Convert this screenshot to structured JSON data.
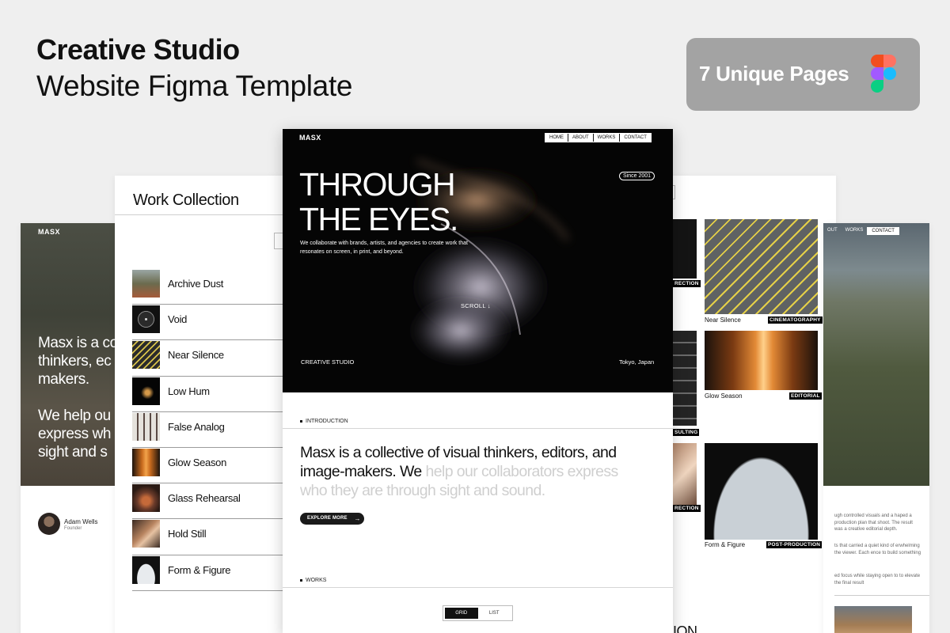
{
  "header": {
    "title": "Creative Studio",
    "subtitle": "Website Figma Template",
    "badge": "7 Unique Pages"
  },
  "far_left": {
    "logo": "MASX",
    "lines": [
      "Masx is a co",
      "thinkers, ec",
      "makers.",
      "We help ou",
      "express wh",
      "sight and s"
    ],
    "author": "Adam Wells",
    "role": "Founder"
  },
  "work_collection": {
    "title": "Work Collection",
    "items": [
      "Archive Dust",
      "Void",
      "Near Silence",
      "Low Hum",
      "False Analog",
      "Glow Season",
      "Glass Rehearsal",
      "Hold Still",
      "Form & Figure"
    ]
  },
  "main": {
    "logo": "MASX",
    "nav": [
      "HOME",
      "ABOUT",
      "WORKS",
      "CONTACT"
    ],
    "headline_1": "THROUGH",
    "headline_2": "THE EYES.",
    "since": "Since 2001",
    "intro": "We collaborate with brands, artists, and agencies to create work that resonates on screen, in print, and beyond.",
    "scroll": "SCROLL ↓",
    "studio": "CREATIVE STUDIO",
    "location": "Tokyo, Japan",
    "section_intro": "INTRODUCTION",
    "statement_dark": "Masx is a collective of visual thinkers, editors, and image-makers. We",
    "statement_light": " help our collaborators express who they are through sight and sound.",
    "explore": "EXPLORE MORE",
    "section_works": "WORKS",
    "toggle_grid": "GRID",
    "toggle_list": "LIST"
  },
  "right": {
    "caps": [
      {
        "title": "Near Silence",
        "tag": "CINEMATOGRAPHY"
      },
      {
        "title": "Glow Season",
        "tag": "EDITORIAL"
      },
      {
        "title": "Form & Figure",
        "tag": "POST-PRODUCTION"
      }
    ],
    "cut_tags": [
      "RECTION",
      "SULTING",
      "RECTION"
    ],
    "bottom_cut": "ION"
  },
  "far_right": {
    "nav": [
      "OUT",
      "WORKS",
      "CONTACT"
    ],
    "para_1": "ugh controlled visuals and a haped a production plan that shoot. The result was a creative editorial depth.",
    "para_2": "ts that carried a quiet kind of erwhelming the viewer. Each ence to build something",
    "para_3": "ed focus while staying open to to elevate the final result"
  },
  "colors": {
    "badge_bg": "#a3a3a3",
    "hero_bg": "#050505",
    "page_bg": "#efefef"
  },
  "icons": [
    "figma-logo-icon",
    "arrow-right-icon",
    "filter-icon"
  ]
}
